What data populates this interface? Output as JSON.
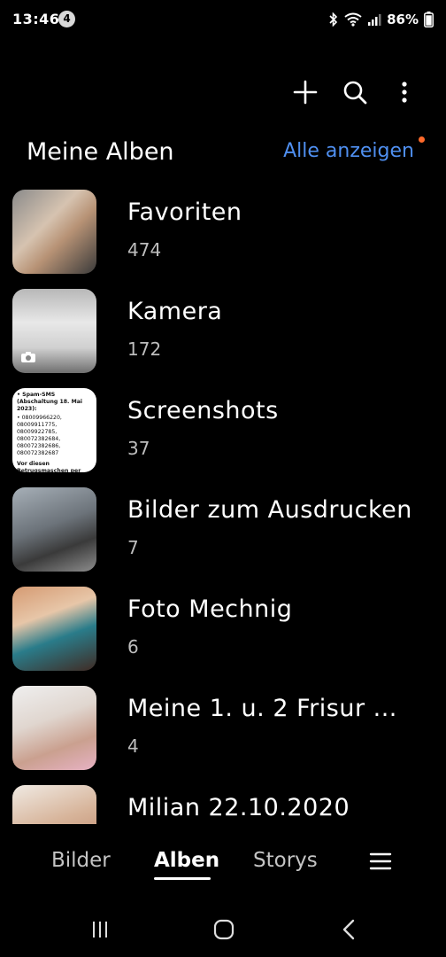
{
  "status_bar": {
    "time": "13:46",
    "notification_count": "4",
    "battery": "86%"
  },
  "header": {
    "title": "Meine Alben",
    "show_all": "Alle anzeigen"
  },
  "albums": [
    {
      "name": "Favoriten",
      "count": "474"
    },
    {
      "name": "Kamera",
      "count": "172"
    },
    {
      "name": "Screenshots",
      "count": "37"
    },
    {
      "name": "Bilder zum Ausdrucken",
      "count": "7"
    },
    {
      "name": "Foto Mechnig",
      "count": "6"
    },
    {
      "name": "Meine 1. u. 2  Frisur ...",
      "count": "4"
    },
    {
      "name": "Milian 22.10.2020",
      "count": ""
    }
  ],
  "screenshot_thumb": {
    "line1": "• Spam-SMS (Abschaltung 18. Mai 2023):",
    "line2": "• 08009966220, 08009911775, 08009922785, 080072382684, 080072382686, 080072382687",
    "line3": "Vor diesen Betrugsmaschen per Telefon wird aktuell gewarnt"
  },
  "bottom_nav": {
    "pictures": "Bilder",
    "albums": "Alben",
    "stories": "Storys"
  },
  "icons": {
    "toolbar": [
      "plus-icon",
      "search-icon",
      "more-vertical-icon"
    ],
    "bottom": [
      "menu-icon"
    ],
    "system": [
      "recent-apps-icon",
      "home-icon",
      "back-icon"
    ]
  },
  "colors": {
    "accent": "#4f8ff0",
    "notification_dot": "#ff6a2b",
    "background": "#000000"
  }
}
